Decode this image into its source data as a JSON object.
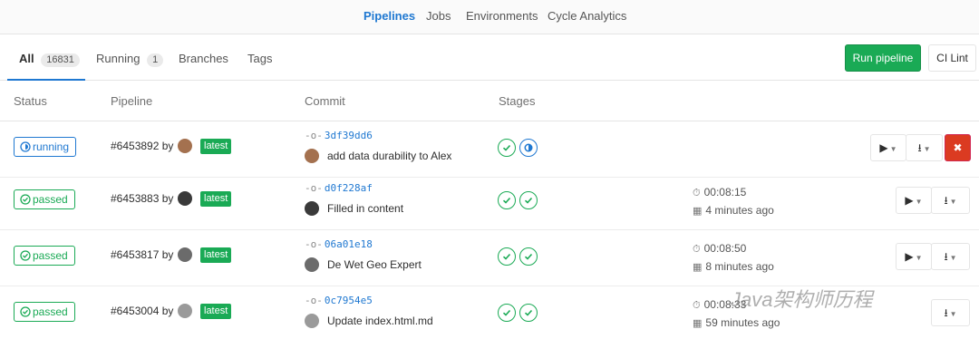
{
  "nav": {
    "items": [
      "Pipelines",
      "Jobs",
      "Environments",
      "Cycle Analytics"
    ]
  },
  "tabs": [
    {
      "label": "All",
      "count": "16831"
    },
    {
      "label": "Running",
      "count": "1"
    },
    {
      "label": "Branches",
      "count": ""
    },
    {
      "label": "Tags",
      "count": ""
    }
  ],
  "actions": {
    "run_pipeline": "Run pipeline",
    "ci_lint": "CI Lint"
  },
  "columns": {
    "status": "Status",
    "pipeline": "Pipeline",
    "commit": "Commit",
    "stages": "Stages"
  },
  "rows": [
    {
      "status": "running",
      "pipeline": "#6453892 by",
      "badge": "latest",
      "sha": "3df39dd6",
      "title": "add data durability to Alex",
      "stages": [
        "passed",
        "running"
      ],
      "duration": "",
      "finished": ""
    },
    {
      "status": "passed",
      "pipeline": "#6453883 by",
      "badge": "latest",
      "sha": "d0f228af",
      "title": "Filled in content",
      "stages": [
        "passed",
        "passed"
      ],
      "duration": "00:08:15",
      "finished": "4 minutes ago"
    },
    {
      "status": "passed",
      "pipeline": "#6453817 by",
      "badge": "latest",
      "sha": "06a01e18",
      "title": "De Wet Geo Expert",
      "stages": [
        "passed",
        "passed"
      ],
      "duration": "00:08:50",
      "finished": "8 minutes ago"
    },
    {
      "status": "passed",
      "pipeline": "#6453004 by",
      "badge": "latest",
      "sha": "0c7954e5",
      "title": "Update index.html.md",
      "stages": [
        "passed",
        "passed"
      ],
      "duration": "00:08:33",
      "finished": "59 minutes ago"
    }
  ],
  "watermark": "Java架构师历程",
  "colors": {
    "accent": "#1f78d1",
    "success": "#1aaa55",
    "danger": "#db3b21"
  },
  "icons": {
    "cancel": "close-icon",
    "play": "play-icon",
    "download": "download-icon",
    "clock": "stopwatch-icon",
    "calendar": "calendar-icon"
  }
}
